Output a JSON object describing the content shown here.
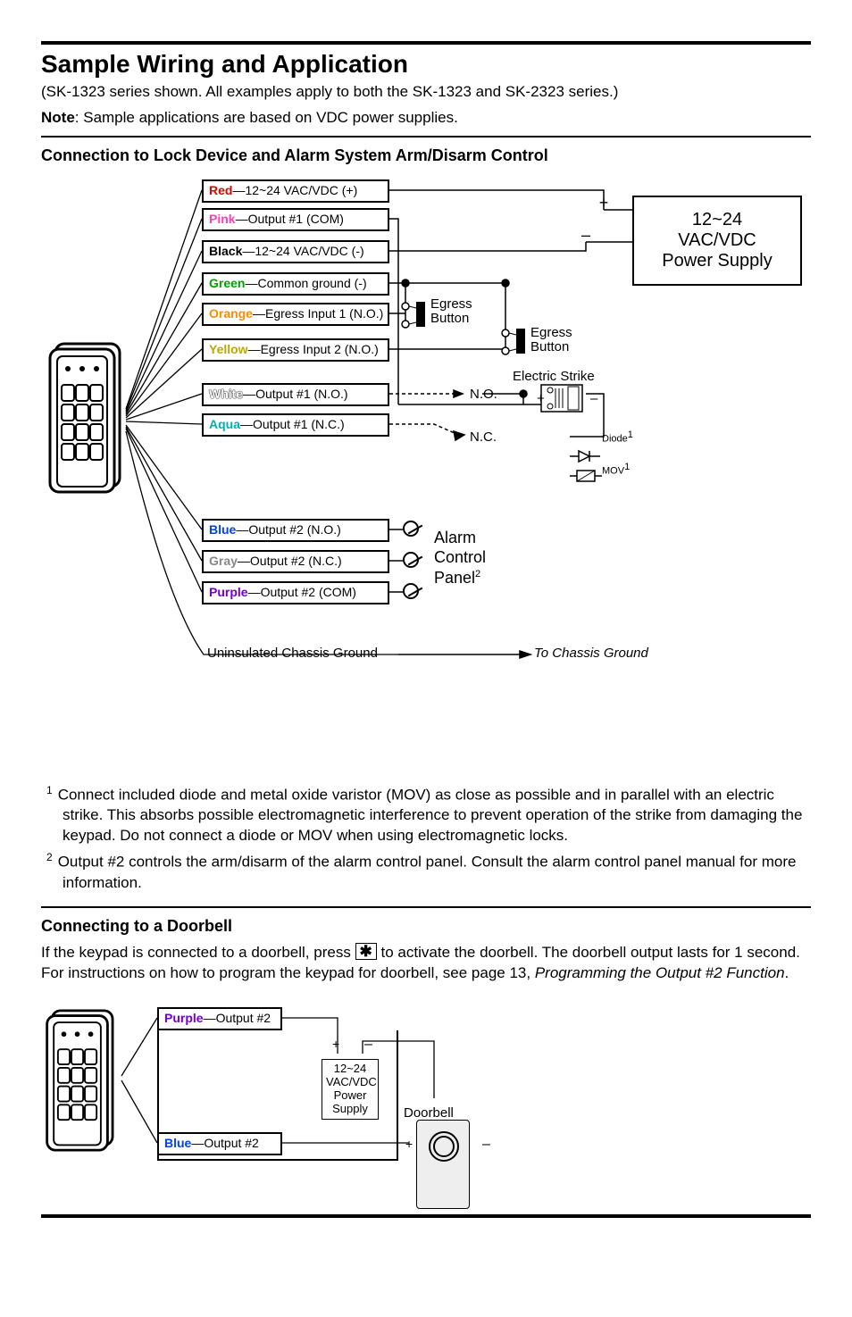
{
  "title": "Sample Wiring and Application",
  "intro_line1": "(SK-1323 series shown.   All examples apply to both the SK-1323 and SK-2323 series.)",
  "note_label": "Note",
  "intro_note": ": Sample applications are based on VDC power supplies.",
  "section1_heading": "Connection to Lock Device and Alarm System Arm/Disarm Control",
  "wires": {
    "red": {
      "color": "Red",
      "desc": "—12~24 VAC/VDC (+)",
      "colorHex": "#e30000"
    },
    "pink": {
      "color": "Pink",
      "desc": "—Output #1 (COM)",
      "colorHex": "#ff3fb0"
    },
    "black": {
      "color": "Black",
      "desc": "—12~24 VAC/VDC (-)",
      "colorHex": "#000"
    },
    "green": {
      "color": "Green",
      "desc": "—Common ground (-)",
      "colorHex": "#00a000"
    },
    "orange": {
      "color": "Orange",
      "desc": "—Egress Input 1 (N.O.)",
      "colorHex": "#ff8c00"
    },
    "yellow": {
      "color": "Yellow",
      "desc": "—Egress Input 2 (N.O.)",
      "colorHex": "#e6c200"
    },
    "white": {
      "color": "White",
      "desc": "—Output #1 (N.O.)",
      "colorHex": "#fff"
    },
    "aqua": {
      "color": "Aqua",
      "desc": "—Output #1 (N.C.)",
      "colorHex": "#00c0c0"
    },
    "blue": {
      "color": "Blue",
      "desc": "—Output #2 (N.O.)",
      "colorHex": "#0040ff"
    },
    "gray": {
      "color": "Gray",
      "desc": "—Output #2 (N.C.)",
      "colorHex": "#888"
    },
    "purple": {
      "color": "Purple",
      "desc": "—Output #2 (COM)",
      "colorHex": "#7000d0"
    }
  },
  "labels": {
    "egress_button": "Egress\nButton",
    "electric_strike": "Electric Strike",
    "no": "N.O.",
    "nc": "N.C.",
    "diode": "Diode",
    "mov": "MOV",
    "alarm": "Alarm\nControl\nPanel",
    "chassis": "Uninsulated Chassis Ground",
    "to_chassis": "To Chassis Ground",
    "ps": "12~24\nVAC/VDC\nPower Supply",
    "plus": "+",
    "minus": "–"
  },
  "footnote1": "Connect included diode and metal oxide varistor (MOV) as close as possible and in parallel with an electric strike.  This absorbs possible electromagnetic interference to prevent operation of the strike from damaging the keypad.  Do not connect a diode or MOV when using electromagnetic locks.",
  "footnote2": "Output #2 controls the arm/disarm of the alarm control panel.  Consult the alarm control panel manual for more information.",
  "section2_heading": "Connecting to a Doorbell",
  "section2_text_a": "If the keypad is connected to a doorbell, press ",
  "section2_text_b": " to activate the doorbell.  The doorbell output lasts for 1 second.  For instructions on how to program the keypad for doorbell, see page 13, ",
  "section2_ital": "Programming the Output #2 Function",
  "section2_end": ".",
  "d2": {
    "purple": {
      "color": "Purple",
      "desc": "—Output #2",
      "colorHex": "#7000d0"
    },
    "blue": {
      "color": "Blue",
      "desc": "—Output #2",
      "colorHex": "#0040ff"
    },
    "ps": "12~24\nVAC/VDC\nPower\nSupply",
    "doorbell": "Doorbell"
  }
}
